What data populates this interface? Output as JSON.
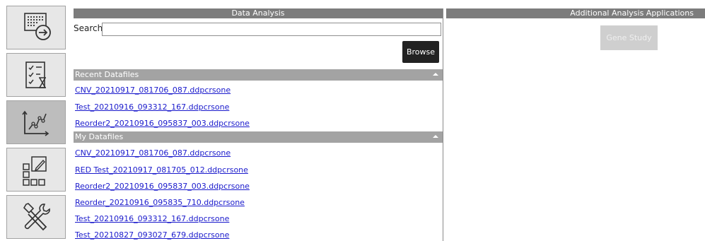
{
  "nav": {
    "items": [
      {
        "icon": "plate-export-icon"
      },
      {
        "icon": "checklist-hourglass-icon"
      },
      {
        "icon": "line-chart-icon"
      },
      {
        "icon": "layout-edit-icon"
      },
      {
        "icon": "tools-icon"
      }
    ],
    "active_index": 2
  },
  "data_analysis": {
    "title": "Data Analysis",
    "search_label": "Search",
    "search_value": "",
    "browse_label": "Browse",
    "recent": {
      "title": "Recent Datafiles",
      "files": [
        "CNV_20210917_081706_087.ddpcrsone",
        "Test_20210916_093312_167.ddpcrsone",
        "Reorder2_20210916_095837_003.ddpcrsone"
      ]
    },
    "mine": {
      "title": "My Datafiles",
      "files": [
        "CNV_20210917_081706_087.ddpcrsone",
        "RED Test_20210917_081705_012.ddpcrsone",
        "Reorder2_20210916_095837_003.ddpcrsone",
        "Reorder_20210916_095835_710.ddpcrsone",
        "Test_20210916_093312_167.ddpcrsone",
        "Test_20210827_093027_679.ddpcrsone"
      ]
    }
  },
  "additional": {
    "title": "Additional Analysis Applications",
    "gene_study_label": "Gene Study"
  },
  "colors": {
    "header_bg": "#7c7c7c",
    "section_bg": "#a3a3a3",
    "link": "#1a1acc",
    "browse_bg": "#222222"
  }
}
